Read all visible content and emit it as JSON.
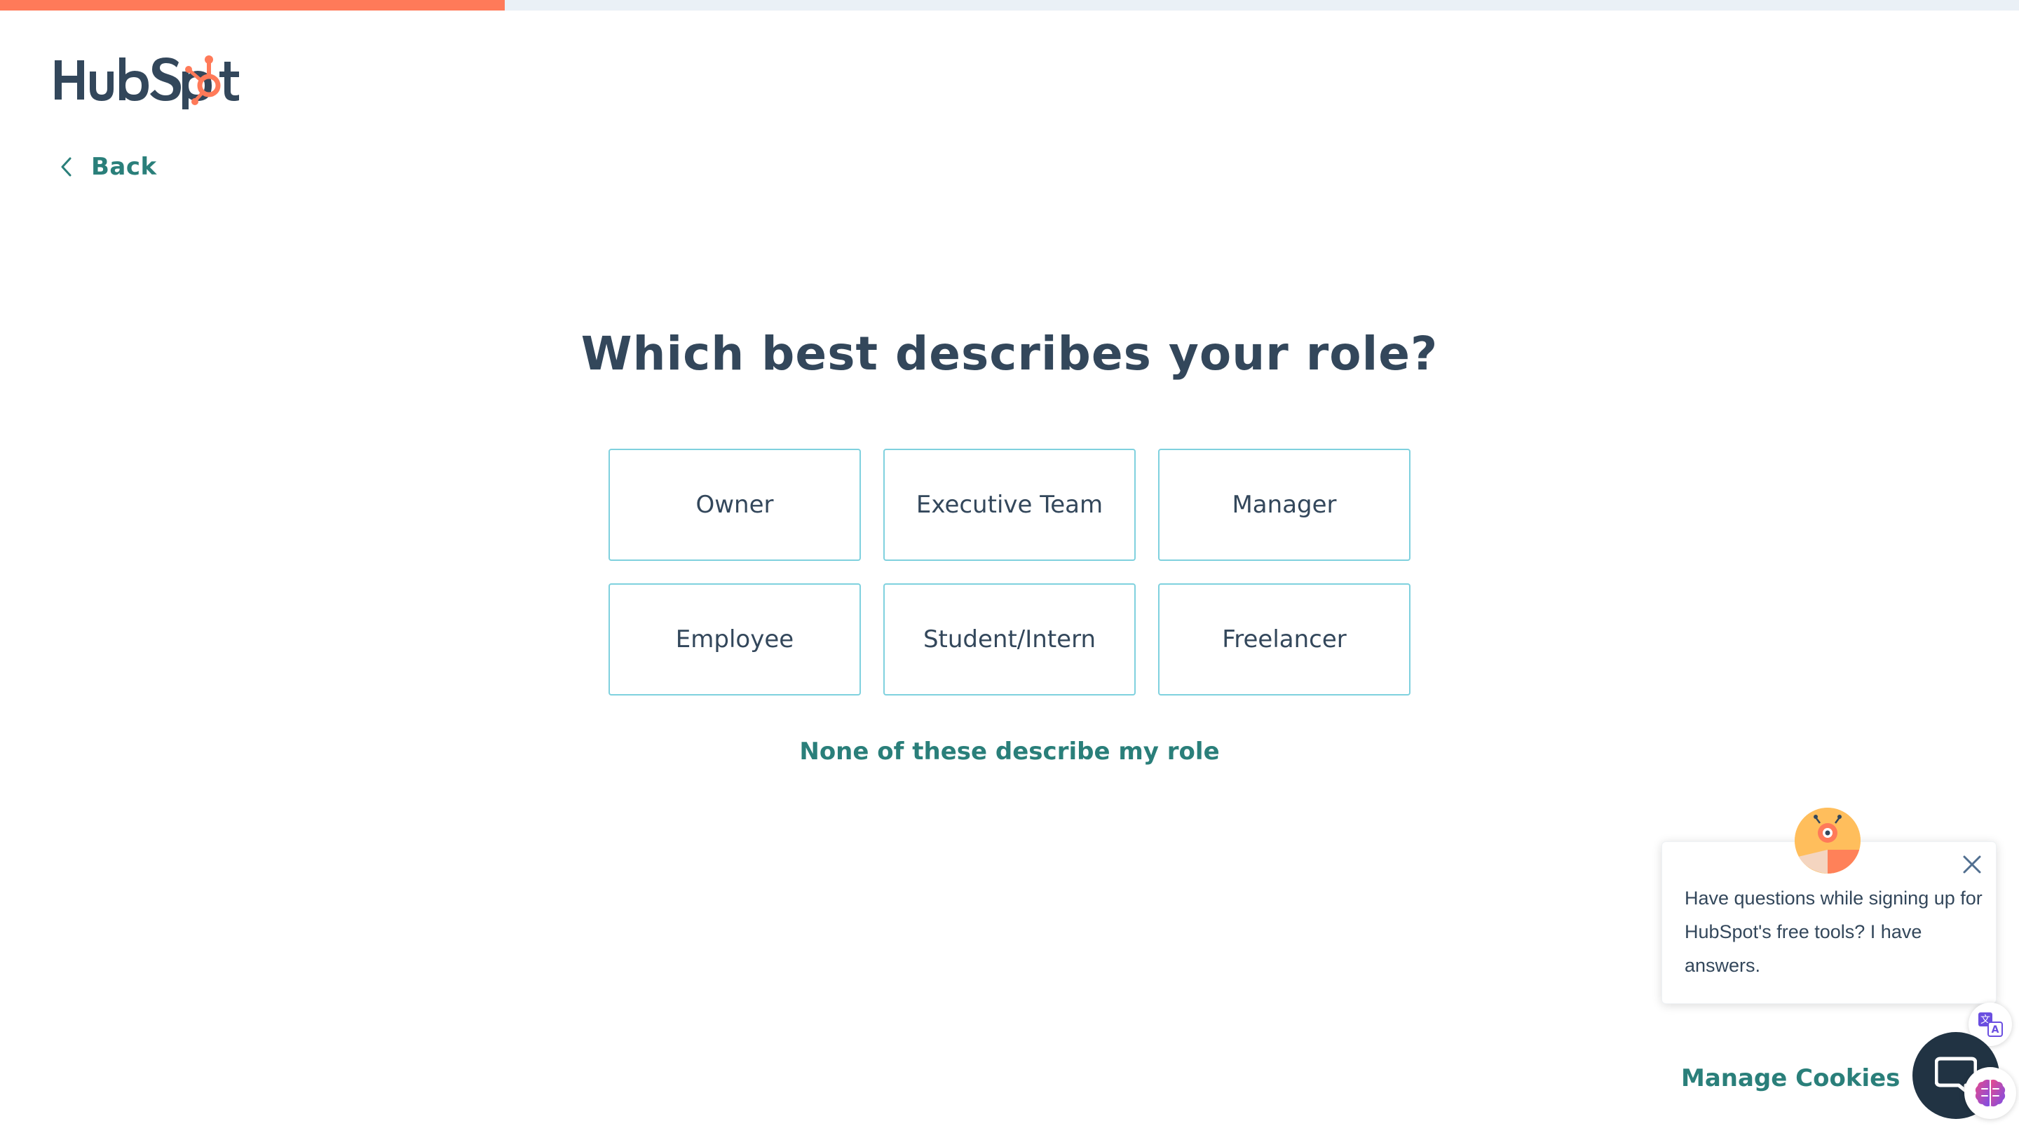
{
  "progress": {
    "percent": 25,
    "fill_color": "#ff7a59",
    "track_color": "#eaf0f6"
  },
  "header": {
    "logo_text": "HubSpot",
    "back_label": "Back"
  },
  "main": {
    "title": "Which best describes your role?",
    "roles": [
      {
        "label": "Owner"
      },
      {
        "label": "Executive Team"
      },
      {
        "label": "Manager"
      },
      {
        "label": "Employee"
      },
      {
        "label": "Student/Intern"
      },
      {
        "label": "Freelancer"
      }
    ],
    "none_link": "None of these describe my role"
  },
  "chat": {
    "message": "Have questions while signing up for HubSpot's free tools? I have answers.",
    "avatar_icon": "robot-avatar-icon",
    "launcher_icon": "chat-bubble-icon"
  },
  "footer": {
    "manage_cookies": "Manage Cookies"
  },
  "colors": {
    "accent": "#ff7a59",
    "link": "#2a7f7a",
    "heading": "#33475b",
    "option_border": "#7fd1de",
    "launcher": "#213343"
  }
}
